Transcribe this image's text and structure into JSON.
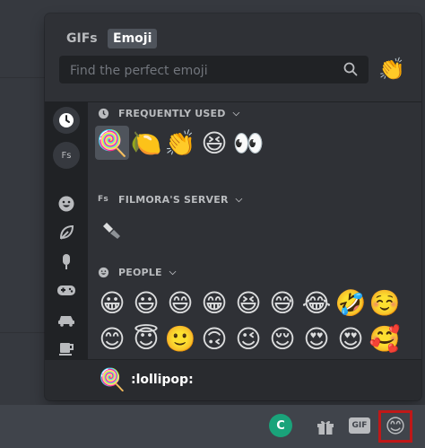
{
  "tabs": {
    "gifs": "GIFs",
    "emoji": "Emoji"
  },
  "search": {
    "placeholder": "Find the perfect emoji"
  },
  "header_emoji": "👏",
  "sidebar": {
    "server_label": "Fs",
    "icons": [
      "clock-icon",
      "server-icon",
      "smiley-icon",
      "leaf-icon",
      "popsicle-icon",
      "gamepad-icon",
      "car-icon",
      "cup-icon",
      "heart-icon"
    ]
  },
  "sections": {
    "frequent": {
      "title": "FREQUENTLY USED",
      "emojis": [
        "🍭",
        "🍋",
        "👏",
        "😆",
        "👀"
      ]
    },
    "server": {
      "title": "FILMORA'S SERVER",
      "icon_label": "Fs"
    },
    "people": {
      "title": "PEOPLE",
      "row1": [
        "😀",
        "😃",
        "😄",
        "😁",
        "😆",
        "😅",
        "😂",
        "🤣",
        "☺️"
      ],
      "row2": [
        "😊",
        "😇",
        "🙂",
        "🙃",
        "😉",
        "😌",
        "😍",
        "😍",
        "🥰"
      ],
      "row3": [
        "😘",
        "😗",
        "😙",
        "😚",
        "😋",
        "😛",
        "😝",
        "😜",
        "🤪"
      ]
    }
  },
  "preview": {
    "emoji": "🍭",
    "name": ":lollipop:"
  },
  "bottom_bar": {
    "gif_label": "GIF",
    "emoji_button": "😊",
    "extension_label": "C"
  },
  "colors": {
    "popup_bg": "#2f3136",
    "sidebar_bg": "#202225",
    "highlight": "#c01818"
  }
}
